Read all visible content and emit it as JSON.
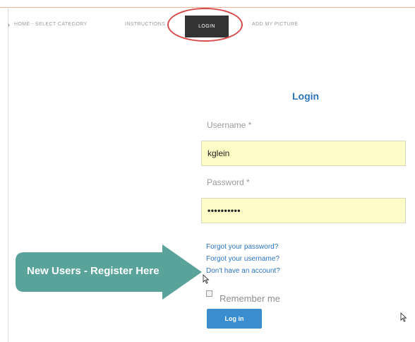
{
  "nav": {
    "items": [
      {
        "label": "HOME - SELECT CATEGORY"
      },
      {
        "label": "INSTRUCTIONS"
      },
      {
        "label": "LOGIN",
        "active": true
      },
      {
        "label": "ADD MY PICTURE"
      }
    ]
  },
  "login": {
    "title": "Login",
    "username_label": "Username *",
    "username_value": "kglein",
    "password_label": "Password *",
    "password_value": "••••••••••",
    "links": {
      "forgot_password": "Forgot your password?",
      "forgot_username": "Forgot your username?",
      "register": "Don't have an account?"
    },
    "remember_label": "Remember me",
    "submit_label": "Log in"
  },
  "callout": {
    "text": "New Users - Register Here"
  },
  "colors": {
    "accent_blue": "#2b74be",
    "button_blue": "#3a8ed0",
    "field_yellow": "#fdfbc6",
    "callout_teal": "#5aa39a",
    "highlight_red": "#d84a4a"
  }
}
